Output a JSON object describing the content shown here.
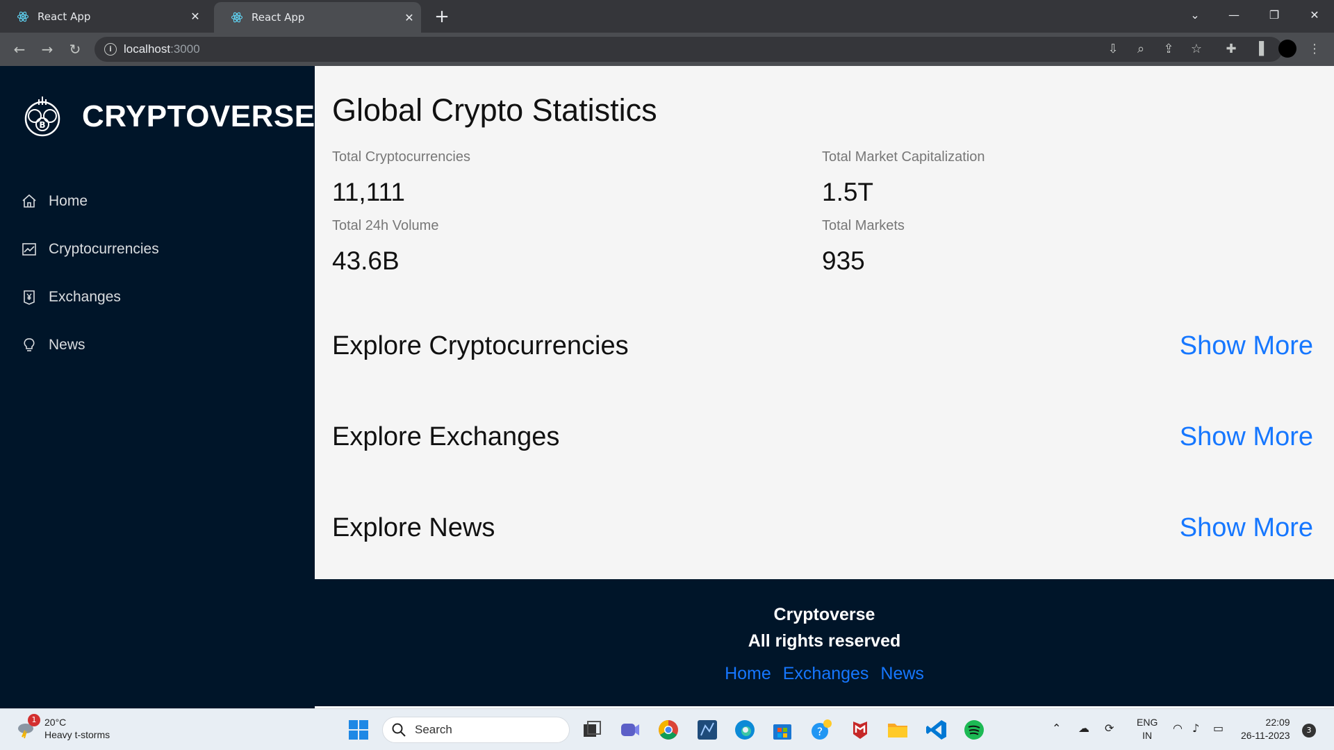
{
  "browser": {
    "tabs": [
      {
        "title": "React App"
      },
      {
        "title": "React App"
      }
    ],
    "url_host": "localhost",
    "url_port": ":3000"
  },
  "sidebar": {
    "brand": "CRYPTOVERSE",
    "items": [
      {
        "label": "Home",
        "icon": "home-icon"
      },
      {
        "label": "Cryptocurrencies",
        "icon": "line-chart-icon"
      },
      {
        "label": "Exchanges",
        "icon": "money-collect-icon"
      },
      {
        "label": "News",
        "icon": "bulb-icon"
      }
    ]
  },
  "main": {
    "title": "Global Crypto Statistics",
    "stats": [
      {
        "label": "Total Cryptocurrencies",
        "value": "11,111"
      },
      {
        "label": "Total Market Capitalization",
        "value": "1.5T"
      },
      {
        "label": "Total 24h Volume",
        "value": "43.6B"
      },
      {
        "label": "Total Markets",
        "value": "935"
      }
    ],
    "sections": [
      {
        "title": "Explore Cryptocurrencies",
        "link": "Show More"
      },
      {
        "title": "Explore Exchanges",
        "link": "Show More"
      },
      {
        "title": "Explore News",
        "link": "Show More"
      }
    ]
  },
  "footer": {
    "line1": "Cryptoverse",
    "line2": "All rights reserved",
    "links": [
      "Home",
      "Exchanges",
      "News"
    ]
  },
  "taskbar": {
    "weather_temp": "20°C",
    "weather_desc": "Heavy t-storms",
    "weather_badge": "1",
    "search_label": "Search",
    "lang_line1": "ENG",
    "lang_line2": "IN",
    "time": "22:09",
    "date": "26-11-2023",
    "notifications": "3"
  },
  "colors": {
    "sidebar_bg": "#001529",
    "link_blue": "#1677ff",
    "chrome_dark": "#35363a",
    "chrome_toolbar": "#4b4d51"
  }
}
